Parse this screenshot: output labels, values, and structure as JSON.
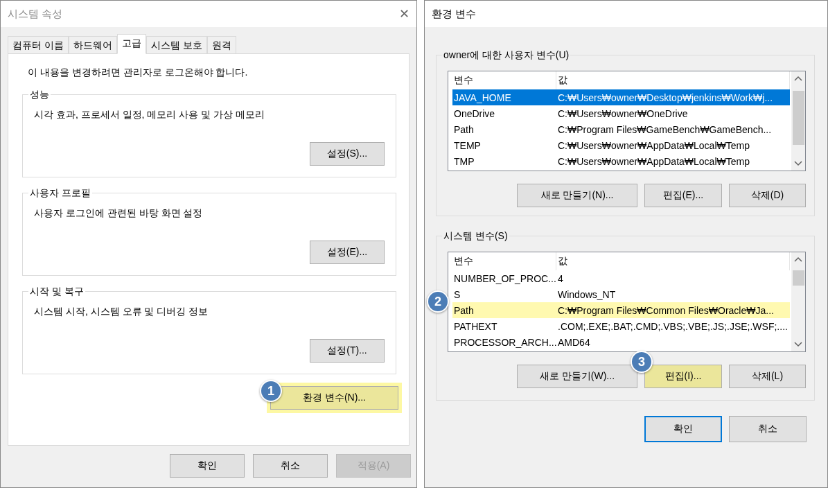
{
  "left_dialog": {
    "title": "시스템 속성",
    "close": "✕",
    "tabs": [
      {
        "label": "컴퓨터 이름",
        "selected": false
      },
      {
        "label": "하드웨어",
        "selected": false
      },
      {
        "label": "고급",
        "selected": true
      },
      {
        "label": "시스템 보호",
        "selected": false
      },
      {
        "label": "원격",
        "selected": false
      }
    ],
    "notice": "이 내용을 변경하려면 관리자로 로그온해야 합니다.",
    "groups": [
      {
        "title": "성능",
        "description": "시각 효과, 프로세서 일정, 메모리 사용 및 가상 메모리",
        "button": "설정(S)..."
      },
      {
        "title": "사용자 프로필",
        "description": "사용자 로그인에 관련된 바탕 화면 설정",
        "button": "설정(E)..."
      },
      {
        "title": "시작 및 복구",
        "description": "시스템 시작, 시스템 오류 및 디버깅 정보",
        "button": "설정(T)..."
      }
    ],
    "env_button": {
      "label": "환경 변수(N)...",
      "highlighted": true,
      "badge": "1"
    },
    "footer_buttons": [
      {
        "label": "확인",
        "disabled": false
      },
      {
        "label": "취소",
        "disabled": false
      },
      {
        "label": "적용(A)",
        "disabled": true
      }
    ]
  },
  "right_dialog": {
    "title": "환경 변수",
    "user_vars": {
      "title": "owner에 대한 사용자 변수(U)",
      "columns": [
        "변수",
        "값"
      ],
      "rows": [
        {
          "name": "JAVA_HOME",
          "value": "C:₩Users₩owner₩Desktop₩jenkins₩Work₩j...",
          "selected": true,
          "highlighted": false
        },
        {
          "name": "OneDrive",
          "value": "C:₩Users₩owner₩OneDrive",
          "selected": false,
          "highlighted": false
        },
        {
          "name": "Path",
          "value": "C:₩Program Files₩GameBench₩GameBench...",
          "selected": false,
          "highlighted": false
        },
        {
          "name": "TEMP",
          "value": "C:₩Users₩owner₩AppData₩Local₩Temp",
          "selected": false,
          "highlighted": false
        },
        {
          "name": "TMP",
          "value": "C:₩Users₩owner₩AppData₩Local₩Temp",
          "selected": false,
          "highlighted": false
        }
      ],
      "buttons": [
        {
          "label": "새로 만들기(N)...",
          "highlighted": false
        },
        {
          "label": "편집(E)...",
          "highlighted": false
        },
        {
          "label": "삭제(D)",
          "highlighted": false
        }
      ]
    },
    "system_vars": {
      "title": "시스템 변수(S)",
      "columns": [
        "변수",
        "값"
      ],
      "rows": [
        {
          "name": "NUMBER_OF_PROC...",
          "value": "4",
          "selected": false,
          "highlighted": false
        },
        {
          "name": "S",
          "value": "Windows_NT",
          "selected": false,
          "highlighted": false
        },
        {
          "name": "Path",
          "value": "C:₩Program Files₩Common Files₩Oracle₩Ja...",
          "selected": false,
          "highlighted": true,
          "badge": "2"
        },
        {
          "name": "PATHEXT",
          "value": ".COM;.EXE;.BAT;.CMD;.VBS;.VBE;.JS;.JSE;.WSF;....",
          "selected": false,
          "highlighted": false
        },
        {
          "name": "PROCESSOR_ARCH...",
          "value": "AMD64",
          "selected": false,
          "highlighted": false
        }
      ],
      "buttons": [
        {
          "label": "새로 만들기(W)...",
          "highlighted": false
        },
        {
          "label": "편집(I)...",
          "highlighted": true,
          "badge": "3"
        },
        {
          "label": "삭제(L)",
          "highlighted": false
        }
      ]
    },
    "footer_buttons": [
      {
        "label": "확인",
        "default": true
      },
      {
        "label": "취소",
        "default": false
      }
    ]
  }
}
